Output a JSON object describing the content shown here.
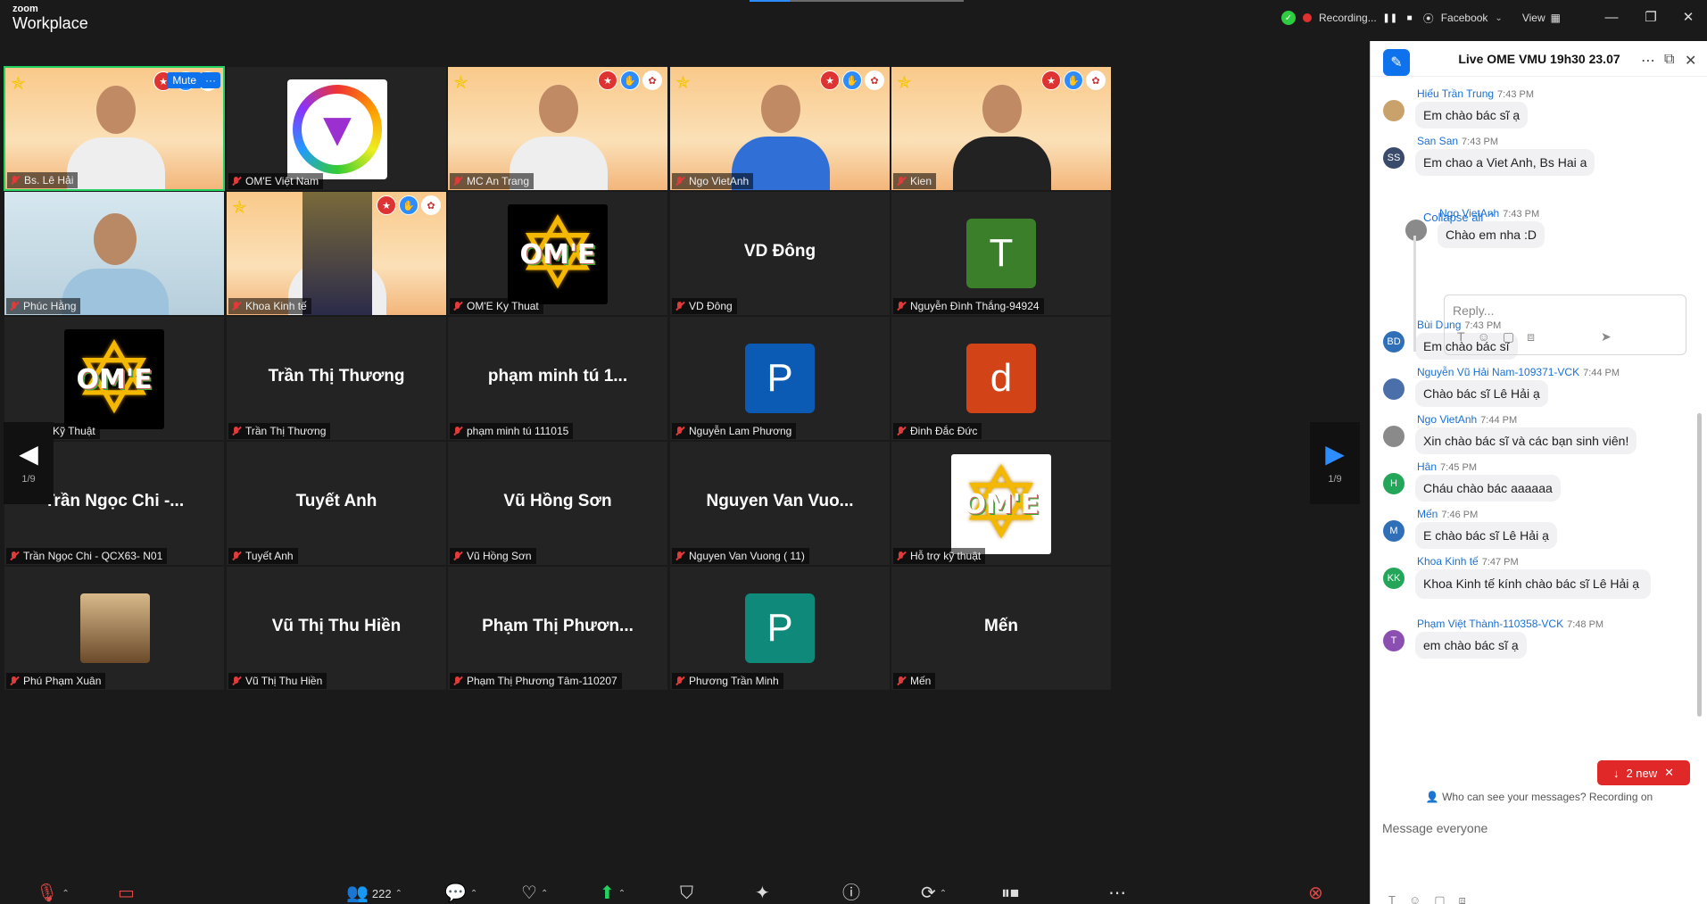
{
  "app": {
    "brand_top": "zoom",
    "brand_bottom": "Workplace"
  },
  "topbar": {
    "recording_label": "Recording...",
    "stream_label": "Facebook",
    "view_label": "View"
  },
  "tiles": [
    {
      "name": "Bs. Lê Hải",
      "kind": "video"
    },
    {
      "name": "OM'E Việt Nam",
      "kind": "logo-rainbow"
    },
    {
      "name": "MC An Trang",
      "kind": "video"
    },
    {
      "name": "Ngo VietAnh",
      "kind": "video"
    },
    {
      "name": "Kien",
      "kind": "video"
    },
    {
      "name": "Phúc Hằng",
      "kind": "video"
    },
    {
      "name": "Khoa Kinh tế",
      "kind": "video"
    },
    {
      "name": "OM'E Ky Thuat",
      "kind": "star"
    },
    {
      "name": "VD Đông",
      "kind": "text",
      "big": "VD Đông"
    },
    {
      "name": "Nguyễn Đình Thắng-94924",
      "kind": "avatar",
      "letter": "T",
      "color": "#3b7f2a"
    },
    {
      "name": "OM'E Kỹ Thuật",
      "kind": "star"
    },
    {
      "name": "Trần Thị Thương",
      "kind": "text",
      "big": "Trần Thị Thương"
    },
    {
      "name": "phạm minh tú 111015",
      "kind": "text",
      "big": "phạm minh tú 1..."
    },
    {
      "name": "Nguyễn Lam Phương",
      "kind": "avatar",
      "letter": "P",
      "color": "#0b5bb5"
    },
    {
      "name": "Đinh Đắc Đức",
      "kind": "avatar",
      "letter": "d",
      "color": "#d24318"
    },
    {
      "name": "Trần Ngọc Chi - QCX63- N01",
      "kind": "text",
      "big": "Trần Ngọc Chi -..."
    },
    {
      "name": "Tuyết Anh",
      "kind": "text",
      "big": "Tuyết Anh"
    },
    {
      "name": "Vũ Hồng Sơn",
      "kind": "text",
      "big": "Vũ Hồng Sơn"
    },
    {
      "name": "Nguyen Van Vuong ( 11)",
      "kind": "text",
      "big": "Nguyen Van Vuo..."
    },
    {
      "name": "Hỗ trợ kỹ thuật",
      "kind": "star-white"
    },
    {
      "name": "Phú Phạm Xuân",
      "kind": "photo"
    },
    {
      "name": "Vũ Thị Thu Hiền",
      "kind": "text",
      "big": "Vũ Thị Thu Hiền"
    },
    {
      "name": "Phạm Thị Phương Tâm-110207",
      "kind": "text",
      "big": "Phạm Thị Phươn..."
    },
    {
      "name": "Phương Trần Minh",
      "kind": "avatar",
      "letter": "P",
      "color": "#0f8a7a"
    },
    {
      "name": "Mến",
      "kind": "text",
      "big": "Mến"
    }
  ],
  "active_controls": {
    "mute": "Mute",
    "more": "···"
  },
  "star_logo_text": "OM'E",
  "pager": {
    "counter": "1/9"
  },
  "toolbar": {
    "participants_count": "222"
  },
  "chat": {
    "title": "Live OME VMU 19h30 23.07",
    "collapse_label": "Collapse all",
    "reply_placeholder": "Reply...",
    "new_label": "2 new",
    "who_can_see": "Who can see your messages? Recording on",
    "input_placeholder": "Message everyone",
    "messages": [
      {
        "name": "Hiếu Trần Trung",
        "time": "7:43 PM",
        "text": "Em chào bác sĩ ạ",
        "avatar": "",
        "color": "#c9a26b"
      },
      {
        "name": "San San",
        "time": "7:43 PM",
        "text": "Em chao a Viet Anh, Bs Hai a",
        "avatar": "SS",
        "color": "#3a4a6b"
      },
      {
        "name": "Ngo VietAnh",
        "time": "7:43 PM",
        "text": "Chào em nha :D",
        "avatar": "",
        "color": "#8a8a8a"
      },
      {
        "name": "Bùi Dung",
        "time": "7:43 PM",
        "text": "Em chào bác sĩ",
        "avatar": "BD",
        "color": "#2f6fb7"
      },
      {
        "name": "Nguyễn Vũ Hải Nam-109371-VCK",
        "time": "7:44 PM",
        "text": "Chào bác sĩ Lê Hải ạ",
        "avatar": "",
        "color": "#4b6fa8"
      },
      {
        "name": "Ngo VietAnh",
        "time": "7:44 PM",
        "text": "Xin chào bác sĩ và các bạn sinh viên!",
        "avatar": "",
        "color": "#8a8a8a"
      },
      {
        "name": "Hân",
        "time": "7:45 PM",
        "text": "Cháu chào bác aaaaaa",
        "avatar": "H",
        "color": "#23a55a"
      },
      {
        "name": "Mến",
        "time": "7:46 PM",
        "text": "E chào bác sĩ Lê Hải ạ",
        "avatar": "M",
        "color": "#2f6fb7"
      },
      {
        "name": "Khoa Kinh tế",
        "time": "7:47 PM",
        "text": "Khoa Kinh tế kính chào bác sĩ Lê Hải ạ",
        "avatar": "KK",
        "color": "#23a55a"
      },
      {
        "name": "Phạm Việt Thành-110358-VCK",
        "time": "7:48 PM",
        "text": "em chào bác sĩ ạ",
        "avatar": "T",
        "color": "#8a4fb0"
      }
    ]
  }
}
